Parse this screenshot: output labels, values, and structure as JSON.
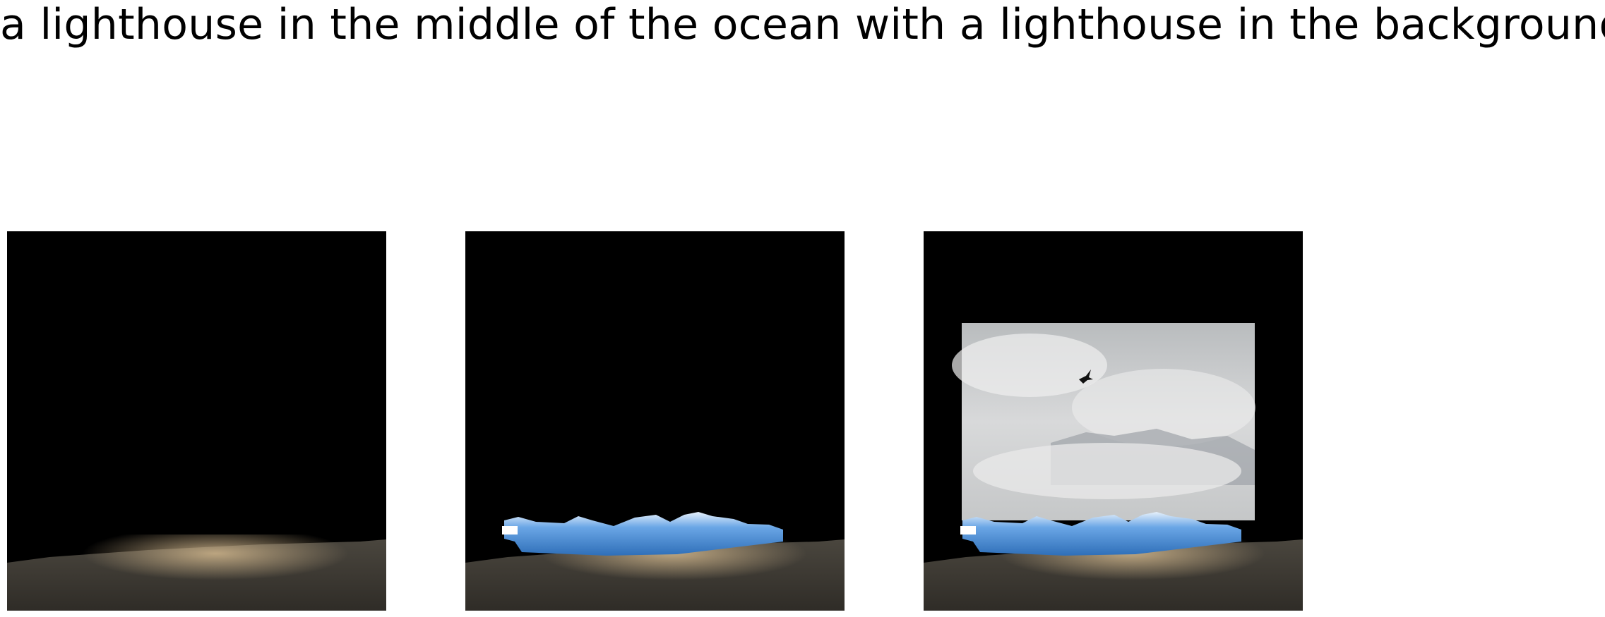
{
  "caption": "a lighthouse in the middle of the ocean with a lighthouse in the background",
  "panels": [
    {
      "name": "panel-water-only",
      "layers": [
        "water"
      ]
    },
    {
      "name": "panel-water-ice",
      "layers": [
        "water",
        "ice"
      ]
    },
    {
      "name": "panel-water-ice-sky",
      "layers": [
        "water",
        "ice",
        "sky"
      ]
    }
  ],
  "colors": {
    "background": "#000000",
    "water_dark": "#3d3a33",
    "water_light": "#b9a27a",
    "ice": "#4a8fd6",
    "sky": "#c9cbcc"
  }
}
